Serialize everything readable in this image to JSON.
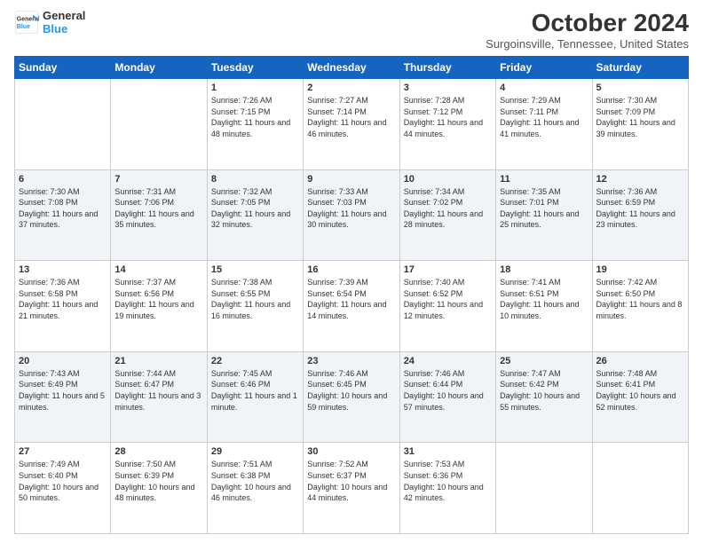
{
  "logo": {
    "line1": "General",
    "line2": "Blue"
  },
  "title": "October 2024",
  "subtitle": "Surgoinsville, Tennessee, United States",
  "weekdays": [
    "Sunday",
    "Monday",
    "Tuesday",
    "Wednesday",
    "Thursday",
    "Friday",
    "Saturday"
  ],
  "weeks": [
    [
      {
        "day": "",
        "sunrise": "",
        "sunset": "",
        "daylight": ""
      },
      {
        "day": "",
        "sunrise": "",
        "sunset": "",
        "daylight": ""
      },
      {
        "day": "1",
        "sunrise": "Sunrise: 7:26 AM",
        "sunset": "Sunset: 7:15 PM",
        "daylight": "Daylight: 11 hours and 48 minutes."
      },
      {
        "day": "2",
        "sunrise": "Sunrise: 7:27 AM",
        "sunset": "Sunset: 7:14 PM",
        "daylight": "Daylight: 11 hours and 46 minutes."
      },
      {
        "day": "3",
        "sunrise": "Sunrise: 7:28 AM",
        "sunset": "Sunset: 7:12 PM",
        "daylight": "Daylight: 11 hours and 44 minutes."
      },
      {
        "day": "4",
        "sunrise": "Sunrise: 7:29 AM",
        "sunset": "Sunset: 7:11 PM",
        "daylight": "Daylight: 11 hours and 41 minutes."
      },
      {
        "day": "5",
        "sunrise": "Sunrise: 7:30 AM",
        "sunset": "Sunset: 7:09 PM",
        "daylight": "Daylight: 11 hours and 39 minutes."
      }
    ],
    [
      {
        "day": "6",
        "sunrise": "Sunrise: 7:30 AM",
        "sunset": "Sunset: 7:08 PM",
        "daylight": "Daylight: 11 hours and 37 minutes."
      },
      {
        "day": "7",
        "sunrise": "Sunrise: 7:31 AM",
        "sunset": "Sunset: 7:06 PM",
        "daylight": "Daylight: 11 hours and 35 minutes."
      },
      {
        "day": "8",
        "sunrise": "Sunrise: 7:32 AM",
        "sunset": "Sunset: 7:05 PM",
        "daylight": "Daylight: 11 hours and 32 minutes."
      },
      {
        "day": "9",
        "sunrise": "Sunrise: 7:33 AM",
        "sunset": "Sunset: 7:03 PM",
        "daylight": "Daylight: 11 hours and 30 minutes."
      },
      {
        "day": "10",
        "sunrise": "Sunrise: 7:34 AM",
        "sunset": "Sunset: 7:02 PM",
        "daylight": "Daylight: 11 hours and 28 minutes."
      },
      {
        "day": "11",
        "sunrise": "Sunrise: 7:35 AM",
        "sunset": "Sunset: 7:01 PM",
        "daylight": "Daylight: 11 hours and 25 minutes."
      },
      {
        "day": "12",
        "sunrise": "Sunrise: 7:36 AM",
        "sunset": "Sunset: 6:59 PM",
        "daylight": "Daylight: 11 hours and 23 minutes."
      }
    ],
    [
      {
        "day": "13",
        "sunrise": "Sunrise: 7:36 AM",
        "sunset": "Sunset: 6:58 PM",
        "daylight": "Daylight: 11 hours and 21 minutes."
      },
      {
        "day": "14",
        "sunrise": "Sunrise: 7:37 AM",
        "sunset": "Sunset: 6:56 PM",
        "daylight": "Daylight: 11 hours and 19 minutes."
      },
      {
        "day": "15",
        "sunrise": "Sunrise: 7:38 AM",
        "sunset": "Sunset: 6:55 PM",
        "daylight": "Daylight: 11 hours and 16 minutes."
      },
      {
        "day": "16",
        "sunrise": "Sunrise: 7:39 AM",
        "sunset": "Sunset: 6:54 PM",
        "daylight": "Daylight: 11 hours and 14 minutes."
      },
      {
        "day": "17",
        "sunrise": "Sunrise: 7:40 AM",
        "sunset": "Sunset: 6:52 PM",
        "daylight": "Daylight: 11 hours and 12 minutes."
      },
      {
        "day": "18",
        "sunrise": "Sunrise: 7:41 AM",
        "sunset": "Sunset: 6:51 PM",
        "daylight": "Daylight: 11 hours and 10 minutes."
      },
      {
        "day": "19",
        "sunrise": "Sunrise: 7:42 AM",
        "sunset": "Sunset: 6:50 PM",
        "daylight": "Daylight: 11 hours and 8 minutes."
      }
    ],
    [
      {
        "day": "20",
        "sunrise": "Sunrise: 7:43 AM",
        "sunset": "Sunset: 6:49 PM",
        "daylight": "Daylight: 11 hours and 5 minutes."
      },
      {
        "day": "21",
        "sunrise": "Sunrise: 7:44 AM",
        "sunset": "Sunset: 6:47 PM",
        "daylight": "Daylight: 11 hours and 3 minutes."
      },
      {
        "day": "22",
        "sunrise": "Sunrise: 7:45 AM",
        "sunset": "Sunset: 6:46 PM",
        "daylight": "Daylight: 11 hours and 1 minute."
      },
      {
        "day": "23",
        "sunrise": "Sunrise: 7:46 AM",
        "sunset": "Sunset: 6:45 PM",
        "daylight": "Daylight: 10 hours and 59 minutes."
      },
      {
        "day": "24",
        "sunrise": "Sunrise: 7:46 AM",
        "sunset": "Sunset: 6:44 PM",
        "daylight": "Daylight: 10 hours and 57 minutes."
      },
      {
        "day": "25",
        "sunrise": "Sunrise: 7:47 AM",
        "sunset": "Sunset: 6:42 PM",
        "daylight": "Daylight: 10 hours and 55 minutes."
      },
      {
        "day": "26",
        "sunrise": "Sunrise: 7:48 AM",
        "sunset": "Sunset: 6:41 PM",
        "daylight": "Daylight: 10 hours and 52 minutes."
      }
    ],
    [
      {
        "day": "27",
        "sunrise": "Sunrise: 7:49 AM",
        "sunset": "Sunset: 6:40 PM",
        "daylight": "Daylight: 10 hours and 50 minutes."
      },
      {
        "day": "28",
        "sunrise": "Sunrise: 7:50 AM",
        "sunset": "Sunset: 6:39 PM",
        "daylight": "Daylight: 10 hours and 48 minutes."
      },
      {
        "day": "29",
        "sunrise": "Sunrise: 7:51 AM",
        "sunset": "Sunset: 6:38 PM",
        "daylight": "Daylight: 10 hours and 46 minutes."
      },
      {
        "day": "30",
        "sunrise": "Sunrise: 7:52 AM",
        "sunset": "Sunset: 6:37 PM",
        "daylight": "Daylight: 10 hours and 44 minutes."
      },
      {
        "day": "31",
        "sunrise": "Sunrise: 7:53 AM",
        "sunset": "Sunset: 6:36 PM",
        "daylight": "Daylight: 10 hours and 42 minutes."
      },
      {
        "day": "",
        "sunrise": "",
        "sunset": "",
        "daylight": ""
      },
      {
        "day": "",
        "sunrise": "",
        "sunset": "",
        "daylight": ""
      }
    ]
  ]
}
